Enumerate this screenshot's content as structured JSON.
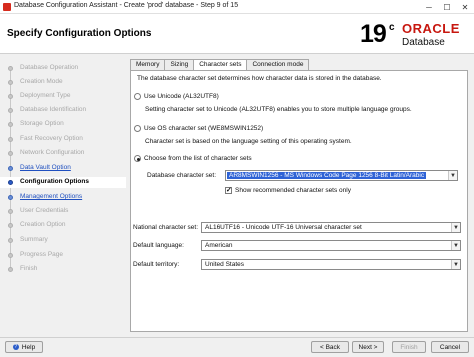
{
  "window": {
    "title": "Database Configuration Assistant - Create 'prod' database - Step 9 of 15",
    "minimize": "─",
    "maximize": "☐",
    "close": "✕"
  },
  "header": {
    "page_title": "Specify Configuration Options",
    "logo": {
      "version": "19",
      "superscript": "c",
      "brand": "ORACLE",
      "product": "Database",
      "brand_color": "#c7170f"
    }
  },
  "sidebar": {
    "items": [
      {
        "label": "Database Operation",
        "state": "disabled"
      },
      {
        "label": "Creation Mode",
        "state": "disabled"
      },
      {
        "label": "Deployment Type",
        "state": "disabled"
      },
      {
        "label": "Database Identification",
        "state": "disabled"
      },
      {
        "label": "Storage Option",
        "state": "disabled"
      },
      {
        "label": "Fast Recovery Option",
        "state": "disabled"
      },
      {
        "label": "Network Configuration",
        "state": "disabled"
      },
      {
        "label": "Data Vault Option",
        "state": "link"
      },
      {
        "label": "Configuration Options",
        "state": "current"
      },
      {
        "label": "Management Options",
        "state": "link"
      },
      {
        "label": "User Credentials",
        "state": "disabled"
      },
      {
        "label": "Creation Option",
        "state": "disabled"
      },
      {
        "label": "Summary",
        "state": "disabled"
      },
      {
        "label": "Progress Page",
        "state": "disabled"
      },
      {
        "label": "Finish",
        "state": "disabled"
      }
    ]
  },
  "tabs": [
    "Memory",
    "Sizing",
    "Character sets",
    "Connection mode"
  ],
  "active_tab": "Character sets",
  "charset": {
    "intro": "The database character set determines how character data is stored in the database.",
    "option_unicode": "Use Unicode (AL32UTF8)",
    "option_unicode_desc": "Setting character set to Unicode (AL32UTF8) enables you to store multiple language groups.",
    "option_os": "Use OS character set (WE8MSWIN1252)",
    "option_os_desc": "Character set is based on the language setting of this operating system.",
    "option_list": "Choose from the list of character sets",
    "selected_option": "list",
    "db_charset_label": "Database character set:",
    "db_charset_value": "AR8MSWIN1256 - MS Windows Code Page 1256 8-Bit Latin/Arabic",
    "show_recommended_label": "Show recommended character sets only",
    "show_recommended_checked": true,
    "national_label": "National character set:",
    "national_value": "AL16UTF16 - Unicode UTF-16 Universal character set",
    "language_label": "Default language:",
    "language_value": "American",
    "territory_label": "Default territory:",
    "territory_value": "United States"
  },
  "footer": {
    "help": "Help",
    "back": "< Back",
    "next": "Next >",
    "finish": "Finish",
    "cancel": "Cancel"
  }
}
